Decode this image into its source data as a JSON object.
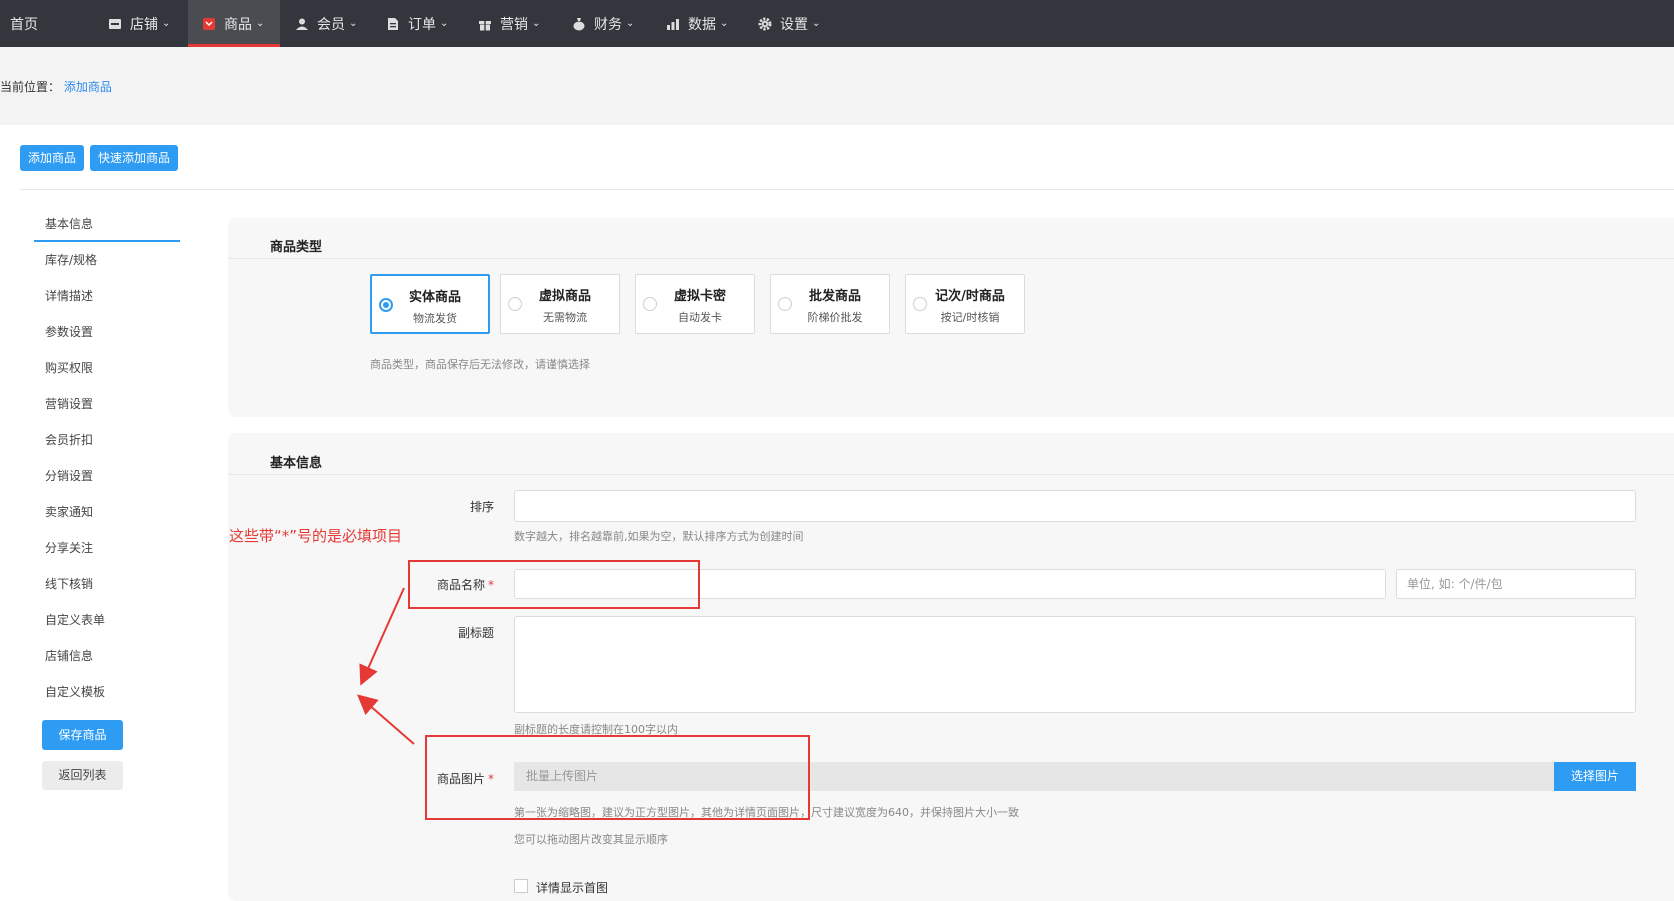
{
  "nav": {
    "home": "首页",
    "items": [
      {
        "label": "店铺",
        "icon": "store-icon"
      },
      {
        "label": "商品",
        "icon": "goods-icon"
      },
      {
        "label": "会员",
        "icon": "user-icon"
      },
      {
        "label": "订单",
        "icon": "order-icon"
      },
      {
        "label": "营销",
        "icon": "gift-icon"
      },
      {
        "label": "财务",
        "icon": "money-bag-icon"
      },
      {
        "label": "数据",
        "icon": "bar-chart-icon"
      },
      {
        "label": "设置",
        "icon": "gear-icon"
      }
    ],
    "active_index": 1,
    "accent": "#e53935"
  },
  "breadcrumb": {
    "prefix": "当前位置：",
    "current": "添加商品"
  },
  "top_buttons": {
    "add": "添加商品",
    "quick_add": "快速添加商品"
  },
  "sidebar": {
    "items": [
      "基本信息",
      "库存/规格",
      "详情描述",
      "参数设置",
      "购买权限",
      "营销设置",
      "会员折扣",
      "分销设置",
      "卖家通知",
      "分享关注",
      "线下核销",
      "自定义表单",
      "店铺信息",
      "自定义模板"
    ],
    "active_index": 0,
    "save": "保存商品",
    "back": "返回列表"
  },
  "goods_type": {
    "title": "商品类型",
    "options": [
      {
        "name": "实体商品",
        "desc": "物流发货",
        "selected": true
      },
      {
        "name": "虚拟商品",
        "desc": "无需物流",
        "selected": false
      },
      {
        "name": "虚拟卡密",
        "desc": "自动发卡",
        "selected": false
      },
      {
        "name": "批发商品",
        "desc": "阶梯价批发",
        "selected": false
      },
      {
        "name": "记次/时商品",
        "desc": "按记/时核销",
        "selected": false
      }
    ],
    "hint": "商品类型，商品保存后无法修改，请谨慎选择"
  },
  "basic_info": {
    "title": "基本信息",
    "sort_label": "排序",
    "sort_hint": "数字越大，排名越靠前,如果为空，默认排序方式为创建时间",
    "name_label": "商品名称",
    "unit_placeholder": "单位, 如: 个/件/包",
    "subtitle_label": "副标题",
    "subtitle_hint": "副标题的长度请控制在100字以内",
    "image_label": "商品图片",
    "upload_placeholder": "批量上传图片",
    "upload_button": "选择图片",
    "image_hint1": "第一张为缩略图，建议为正方型图片，其他为详情页面图片，尺寸建议宽度为640，并保持图片大小一致",
    "image_hint2": "您可以拖动图片改变其显示顺序",
    "first_image_checkbox": "详情显示首图",
    "required_mark": "*"
  },
  "annotation": {
    "text": "这些带“*”号的是必填项目",
    "color": "#e53935"
  },
  "colors": {
    "primary": "#2f9cf4",
    "nav_bg": "#33363d"
  }
}
